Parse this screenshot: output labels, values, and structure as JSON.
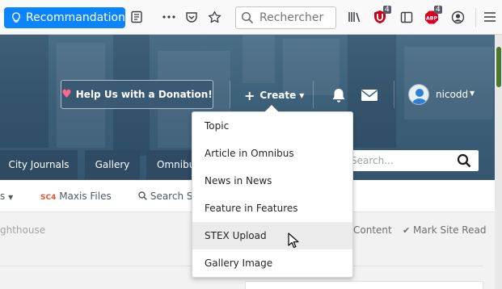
{
  "browser": {
    "recommendation_label": "Recommandation",
    "search_placeholder": "Rechercher",
    "ublock_badge": "4",
    "adblock_badge": "4"
  },
  "header": {
    "donate_label": "Help Us with a Donation!",
    "create_label": "Create",
    "username": "nicodd"
  },
  "nav": {
    "tabs": [
      "City Journals",
      "Gallery",
      "Omnibu"
    ],
    "search_placeholder": "Search..."
  },
  "subnav": {
    "items": [
      "s",
      "Maxis Files",
      "Search S"
    ],
    "sc4_tag": "SC4"
  },
  "content": {
    "crumb": "ghthouse",
    "unread_label": "Content",
    "mark_read_label": "Mark Site Read"
  },
  "create_menu": {
    "items": [
      "Topic",
      "Article in Omnibus",
      "News in News",
      "Feature in Features",
      "STEX Upload",
      "Gallery Image"
    ],
    "highlighted_index": 4
  },
  "colors": {
    "browser_accent": "#0a84ff",
    "header_blue": "#3d6079",
    "nav_tab": "#2f4a63",
    "ublock_red": "#c4001e",
    "abp_red": "#d80020"
  }
}
